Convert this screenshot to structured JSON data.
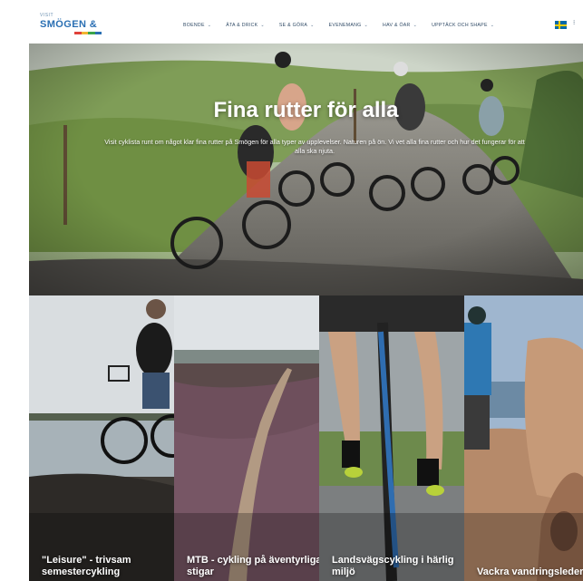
{
  "header": {
    "logo_small": "VISIT",
    "logo_main": "SMÖGEN &",
    "nav": [
      {
        "label": "BOENDE"
      },
      {
        "label": "ÄTA & DRICK"
      },
      {
        "label": "SE & GÖRA"
      },
      {
        "label": "EVENEMANG"
      },
      {
        "label": "HAV & ÖAR"
      },
      {
        "label": "UPPTÄCK OCH SHAPE"
      }
    ],
    "language": "SV"
  },
  "hero": {
    "title": "Fina rutter för alla",
    "subtitle": "Visit cyklista runt om något klar fina rutter på Smögen för alla typer av upplevelser. Naturen på ön. Vi vet alla fina rutter och hur det fungerar för att alla ska njuta."
  },
  "cards": [
    {
      "title": "\"Leisure\" - trivsam semestercykling"
    },
    {
      "title": "MTB - cykling på äventyrliga stigar"
    },
    {
      "title": "Landsvägscykling i härlig miljö"
    },
    {
      "title": "Vackra vandringsleder"
    }
  ],
  "colors": {
    "brand_blue": "#2a6fb3",
    "nav_text": "#2f4a66",
    "logo_bar": [
      "#e0413a",
      "#f2b531",
      "#3aa54a",
      "#2a6fb3"
    ]
  }
}
